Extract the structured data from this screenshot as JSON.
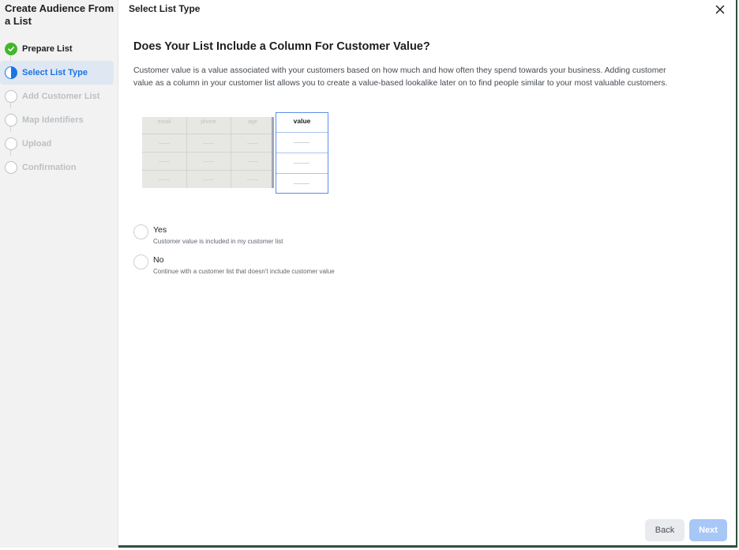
{
  "sidebar": {
    "title": "Create Audience From a List",
    "steps": [
      {
        "label": "Prepare List",
        "state": "done"
      },
      {
        "label": "Select List Type",
        "state": "active"
      },
      {
        "label": "Add Customer List",
        "state": "pending"
      },
      {
        "label": "Map Identifiers",
        "state": "pending"
      },
      {
        "label": "Upload",
        "state": "pending"
      },
      {
        "label": "Confirmation",
        "state": "pending"
      }
    ]
  },
  "header": {
    "title": "Select List Type",
    "close_icon": "close-icon"
  },
  "main": {
    "heading": "Does Your List Include a Column For Customer Value?",
    "description": "Customer value is a value associated with your customers based on how much and how often they spend towards your business. Adding customer value as a column in your customer list allows you to create a value-based lookalike later on to find people similar to your most valuable customers.",
    "illustration": {
      "columns": [
        "email",
        "phone",
        "age"
      ],
      "value_column": "value"
    },
    "options": [
      {
        "title": "Yes",
        "subtitle": "Customer value is included in my customer list",
        "selected": false
      },
      {
        "title": "No",
        "subtitle": "Continue with a customer list that doesn't include customer value",
        "selected": false
      }
    ]
  },
  "footer": {
    "back_label": "Back",
    "next_label": "Next",
    "next_disabled": true
  },
  "colors": {
    "accent": "#1b74e4",
    "success": "#42b72a",
    "next_disabled": "#a7c7f7"
  }
}
